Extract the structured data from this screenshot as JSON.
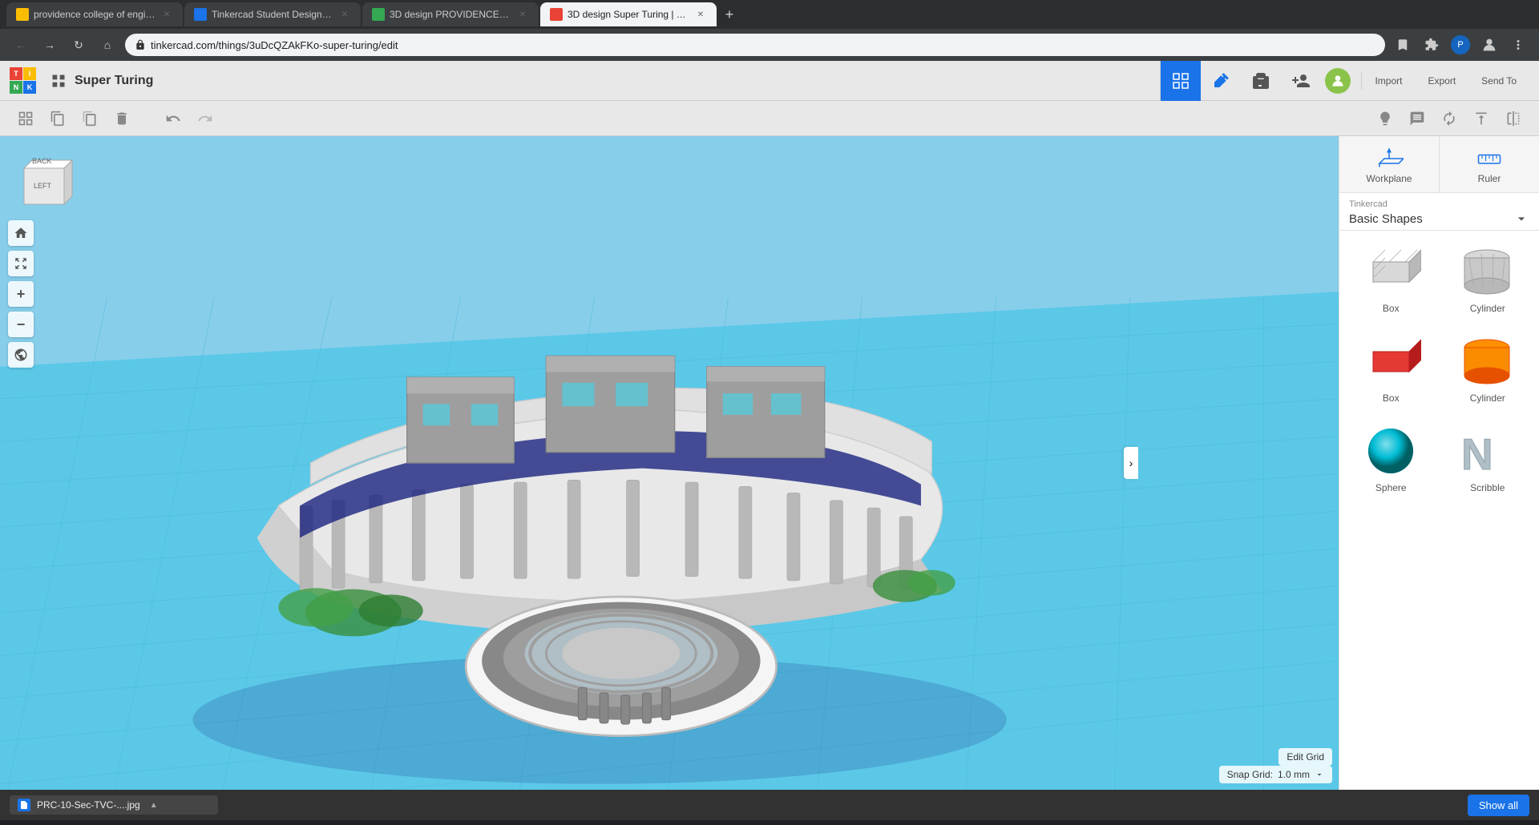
{
  "browser": {
    "tabs": [
      {
        "id": "t1",
        "label": "providence college of engineerin...",
        "favicon_color": "#fbbc04",
        "active": false
      },
      {
        "id": "t2",
        "label": "Tinkercad Student Design Conte...",
        "favicon_color": "#1a73e8",
        "active": false
      },
      {
        "id": "t3",
        "label": "3D design PROVIDENCE | Tinker...",
        "favicon_color": "#34a853",
        "active": false
      },
      {
        "id": "t4",
        "label": "3D design Super Turing | Tinkerc...",
        "favicon_color": "#ea4335",
        "active": true
      }
    ],
    "address": "tinkercad.com/things/3uDcQZAkFKo-super-turing/edit"
  },
  "app": {
    "title": "Super Turing",
    "toolbar": {
      "import_label": "Import",
      "export_label": "Export",
      "send_to_label": "Send To"
    },
    "right_sidebar": {
      "source_category": "Tinkercad",
      "source_name": "Basic Shapes",
      "shapes": [
        {
          "label": "Box",
          "type": "box-wire"
        },
        {
          "label": "Cylinder",
          "type": "cylinder-wire"
        },
        {
          "label": "Box",
          "type": "box-red"
        },
        {
          "label": "Cylinder",
          "type": "cylinder-orange"
        },
        {
          "label": "Sphere",
          "type": "sphere-blue"
        },
        {
          "label": "Scribble",
          "type": "scribble"
        }
      ]
    },
    "viewport": {
      "snap_grid_label": "Snap Grid:",
      "snap_grid_value": "1.0 mm",
      "edit_grid_label": "Edit Grid"
    },
    "workplane_label": "Workplane",
    "ruler_label": "Ruler"
  },
  "bottom_bar": {
    "file_name": "PRC-10-Sec-TVC-....jpg",
    "show_all_label": "Show all"
  }
}
